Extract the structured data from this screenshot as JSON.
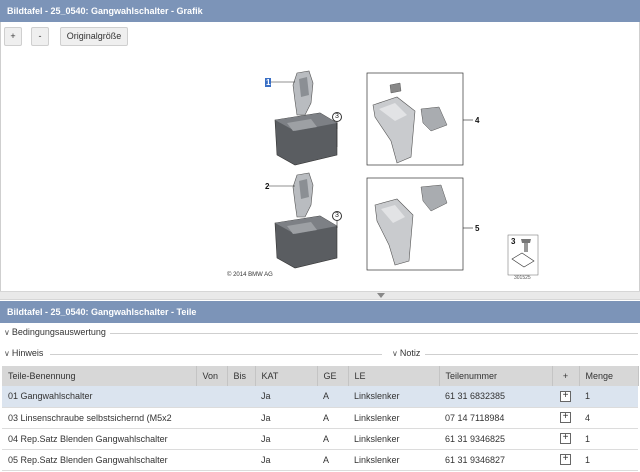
{
  "graphic_panel": {
    "title": "Bildtafel - 25_0540: Gangwahlschalter - Grafik",
    "zoom_in_label": "+",
    "zoom_out_label": "-",
    "original_size_label": "Originalgröße",
    "callouts": [
      "1",
      "2",
      "3",
      "3",
      "4",
      "5",
      "3"
    ],
    "copyright": "© 2014 BMW AG",
    "image_id": "301525"
  },
  "parts_panel": {
    "title": "Bildtafel - 25_0540: Gangwahlschalter - Teile",
    "bedingung_label": "Bedingungsauswertung",
    "hinweis_label": "Hinweis",
    "notiz_label": "Notiz",
    "columns": [
      "Teile-Benennung",
      "Von",
      "Bis",
      "KAT",
      "GE",
      "LE",
      "Teilenummer",
      "+",
      "Menge"
    ],
    "rows": [
      {
        "name": "01 Gangwahlschalter",
        "von": "",
        "bis": "",
        "kat": "Ja",
        "ge": "A",
        "le": "Linkslenker",
        "nr": "61 31 6832385",
        "menge": "1"
      },
      {
        "name": "03 Linsenschraube selbstsichernd (M5x2",
        "von": "",
        "bis": "",
        "kat": "Ja",
        "ge": "A",
        "le": "Linkslenker",
        "nr": "07 14 7118984",
        "menge": "4"
      },
      {
        "name": "04 Rep.Satz Blenden Gangwahlschalter",
        "von": "",
        "bis": "",
        "kat": "Ja",
        "ge": "A",
        "le": "Linkslenker",
        "nr": "61 31 9346825",
        "menge": "1"
      },
      {
        "name": "05 Rep.Satz Blenden Gangwahlschalter",
        "von": "",
        "bis": "",
        "kat": "Ja",
        "ge": "A",
        "le": "Linkslenker",
        "nr": "61 31 9346827",
        "menge": "1"
      }
    ]
  },
  "colors": {
    "titlebar": "#7c94b8",
    "selected_row": "#dbe4ef",
    "header_bg": "#d7d7d7"
  }
}
